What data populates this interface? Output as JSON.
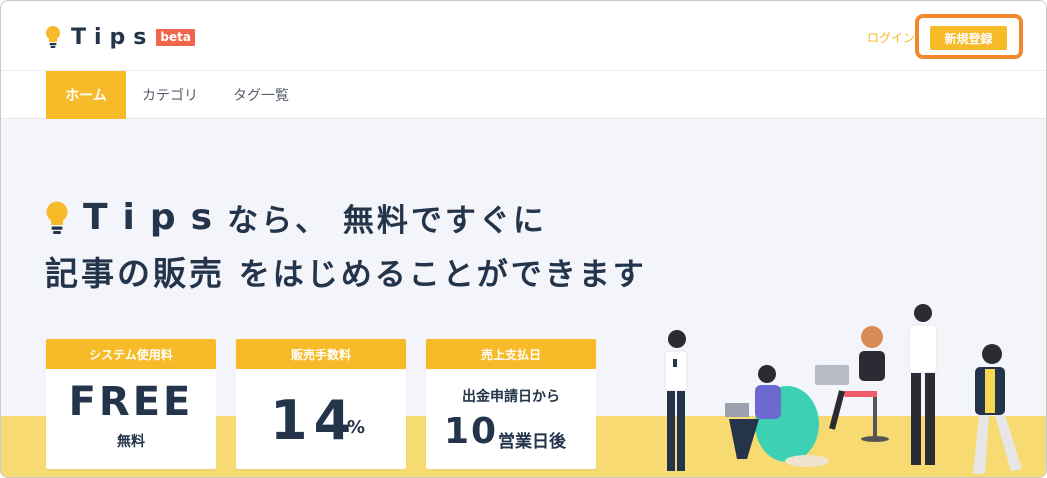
{
  "header": {
    "logo_text": "Tips",
    "logo_badge": "beta",
    "login_label": "ログイン",
    "register_label": "新規登録"
  },
  "nav": {
    "items": [
      {
        "label": "ホーム",
        "active": true
      },
      {
        "label": "カテゴリ",
        "active": false
      },
      {
        "label": "タグ一覧",
        "active": false
      }
    ]
  },
  "hero": {
    "headline_brand": "Tips",
    "headline_line1_rest": "なら、 無料ですぐに",
    "headline_line2_strong": "記事の販売",
    "headline_line2_rest": " をはじめることができます"
  },
  "cards": [
    {
      "title": "システム使用料",
      "value": "FREE",
      "note": "無料"
    },
    {
      "title": "販売手数料",
      "value": "14",
      "unit": "%"
    },
    {
      "title": "売上支払日",
      "pre": "出金申請日から",
      "value": "10",
      "unit": "営業日後"
    }
  ],
  "colors": {
    "accent": "#f7bb29",
    "highlight_border": "#f18a2c",
    "beta_badge": "#f2654a",
    "text": "#24344a",
    "hero_bg": "#f3f5fa",
    "floor": "#f8da73"
  },
  "icons": [
    "lightbulb-icon"
  ]
}
